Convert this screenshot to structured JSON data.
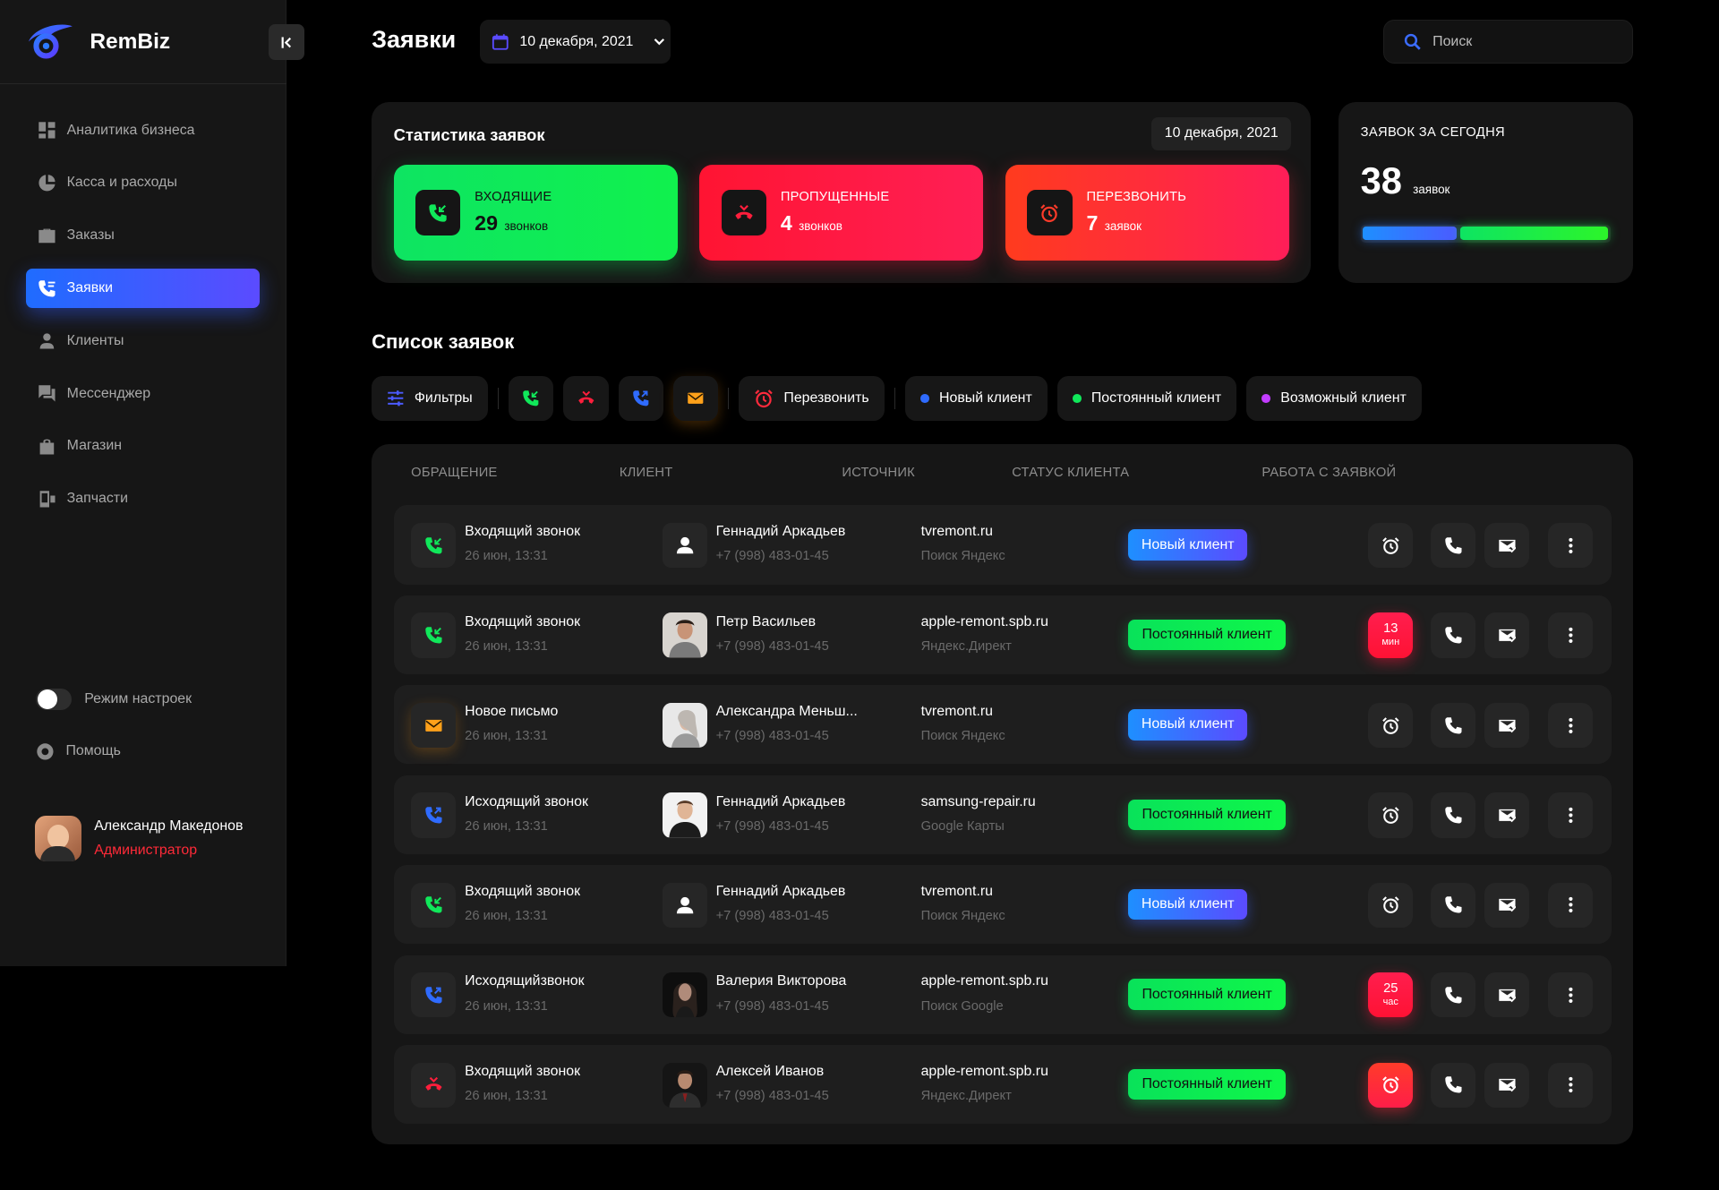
{
  "app": {
    "name": "RemBiz"
  },
  "sidebar": {
    "items": [
      {
        "label": "Аналитика бизнеса",
        "icon": "dashboard-icon"
      },
      {
        "label": "Касса и расходы",
        "icon": "pie-chart-icon"
      },
      {
        "label": "Заказы",
        "icon": "briefcase-icon"
      },
      {
        "label": "Заявки",
        "icon": "phone-calls-icon",
        "active": true
      },
      {
        "label": "Клиенты",
        "icon": "person-icon"
      },
      {
        "label": "Мессенджер",
        "icon": "chat-icon"
      },
      {
        "label": "Магазин",
        "icon": "shopping-bag-icon"
      },
      {
        "label": "Запчасти",
        "icon": "device-parts-icon"
      }
    ],
    "settings_mode": "Режим настроек",
    "help": "Помощь",
    "user": {
      "name": "Александр Македонов",
      "role": "Администратор"
    }
  },
  "header": {
    "title": "Заявки",
    "date": "10 декабря, 2021",
    "search_placeholder": "Поиск"
  },
  "stats": {
    "title": "Статистика заявок",
    "date": "10 декабря, 2021",
    "cards": [
      {
        "label": "ВХОДЯЩИЕ",
        "value": "29",
        "unit": "звонков"
      },
      {
        "label": "ПРОПУЩЕННЫЕ",
        "value": "4",
        "unit": "звонков"
      },
      {
        "label": "ПЕРЕЗВОНИТЬ",
        "value": "7",
        "unit": "заявок"
      }
    ]
  },
  "today": {
    "title": "ЗАЯВОК ЗА СЕГОДНЯ",
    "value": "38",
    "unit": "заявок",
    "bar_fraction_blue": 0.39,
    "bar_fraction_green": 0.61
  },
  "list": {
    "title": "Список заявок",
    "filters": {
      "filters_label": "Фильтры",
      "callback_label": "Перезвонить",
      "new_client": "Новый клиент",
      "regular_client": "Постоянный клиент",
      "possible_client": "Возможный клиент"
    },
    "columns": [
      "ОБРАЩЕНИЕ",
      "КЛИЕНТ",
      "ИСТОЧНИК",
      "СТАТУС КЛИЕНТА",
      "РАБОТА С ЗАЯВКОЙ"
    ],
    "rows": [
      {
        "type": "Входящий звонок",
        "date": "26 июн, 13:31",
        "client": "Геннадий Аркадьев",
        "phone": "+7 (998) 483-01-45",
        "source": "tvremont.ru",
        "channel": "Поиск Яндекс",
        "status": "Новый клиент"
      },
      {
        "type": "Входящий звонок",
        "date": "26 июн, 13:31",
        "client": "Петр Васильев",
        "phone": "+7 (998) 483-01-45",
        "source": "apple-remont.spb.ru",
        "channel": "Яндекс.Директ",
        "status": "Постоянный клиент",
        "timer": {
          "n": "13",
          "u": "мин"
        }
      },
      {
        "type": "Новое письмо",
        "date": "26 июн, 13:31",
        "client": "Александра Меньш...",
        "phone": "+7 (998) 483-01-45",
        "source": "tvremont.ru",
        "channel": "Поиск Яндекс",
        "status": "Новый клиент"
      },
      {
        "type": "Исходящий звонок",
        "date": "26 июн, 13:31",
        "client": "Геннадий Аркадьев",
        "phone": "+7 (998) 483-01-45",
        "source": "samsung-repair.ru",
        "channel": "Google Карты",
        "status": "Постоянный клиент"
      },
      {
        "type": "Входящий звонок",
        "date": "26 июн, 13:31",
        "client": "Геннадий Аркадьев",
        "phone": "+7 (998) 483-01-45",
        "source": "tvremont.ru",
        "channel": "Поиск Яндекс",
        "status": "Новый клиент"
      },
      {
        "type": "Исходящийзвонок",
        "date": "26 июн, 13:31",
        "client": "Валерия Викторова",
        "phone": "+7 (998) 483-01-45",
        "source": "apple-remont.spb.ru",
        "channel": "Поиск Google",
        "status": "Постоянный клиент",
        "timer": {
          "n": "25",
          "u": "час"
        }
      },
      {
        "type": "Входящий звонок",
        "date": "26 июн, 13:31",
        "client": "Алексей Иванов",
        "phone": "+7 (998) 483-01-45",
        "source": "apple-remont.spb.ru",
        "channel": "Яндекс.Директ",
        "status": "Постоянный клиент"
      }
    ]
  },
  "colors": {
    "accent_blue": "#1f6cff",
    "green": "#0ee462",
    "red": "#ff1432",
    "orange": "#ff9a1a",
    "purple": "#c23cff",
    "background": "#000000",
    "panel": "#161616"
  }
}
